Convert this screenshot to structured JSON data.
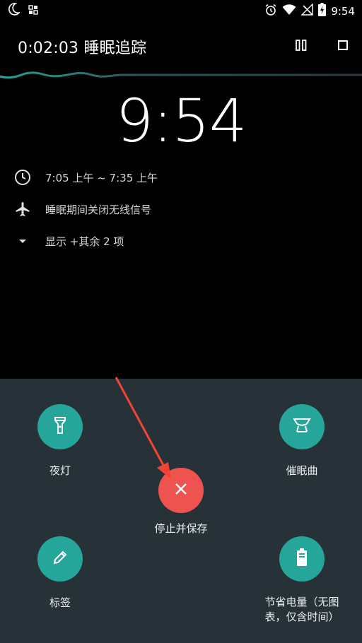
{
  "status_bar": {
    "time": "9:54",
    "left_icons": [
      "moon-icon",
      "grid-icon"
    ],
    "right_icons": [
      "alarm-icon",
      "wifi-icon",
      "no-signal-icon",
      "battery-charging-icon"
    ]
  },
  "header": {
    "elapsed_title": "0:02:03 睡眠追踪",
    "pause_icon": "pause-icon",
    "stop_icon": "stop-square-icon"
  },
  "clock": "9:54",
  "info": {
    "alarm_window": "7:05 上午 ~ 7:35 上午",
    "airplane_mode": "睡眠期间关闭无线信号",
    "show_more": "显示 +其余 2 项"
  },
  "actions": {
    "night_light": "夜灯",
    "lullaby": "催眠曲",
    "stop_save": "停止并保存",
    "tag": "标签",
    "battery_saver": "节省电量（无图\n表，仅含时间）"
  },
  "colors": {
    "panel_bg": "#263238",
    "fab_teal": "#26a69a",
    "fab_red": "#ef5350",
    "arrow_red": "#f44336"
  }
}
